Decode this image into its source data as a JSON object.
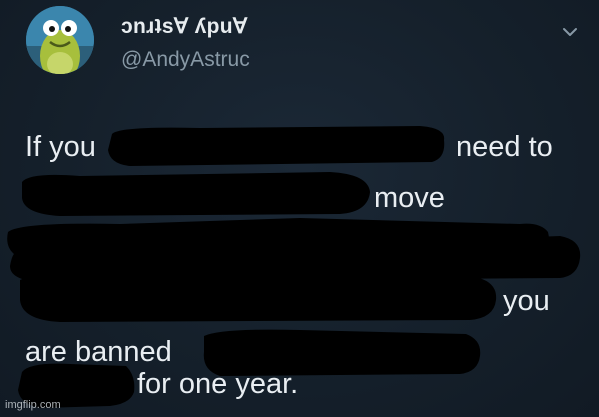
{
  "tweet": {
    "display_name": "ɔnɹʇs∀ ʎpu∀",
    "handle": "@AndyAstruc",
    "menu_icon": "chevron-down-icon",
    "avatar_icon": "cartoon-fish-avatar",
    "lines": {
      "l1_start": "If you",
      "l1_end": "need to",
      "l2_end": "move",
      "l5_end": "you",
      "l6_start": "are banned",
      "l7_end": "for one year."
    },
    "redacted": true
  },
  "watermark": "imgflip.com",
  "colors": {
    "background": "#15202b",
    "text": "#e9eef2",
    "handle": "#8899a6",
    "redaction": "#000000"
  }
}
